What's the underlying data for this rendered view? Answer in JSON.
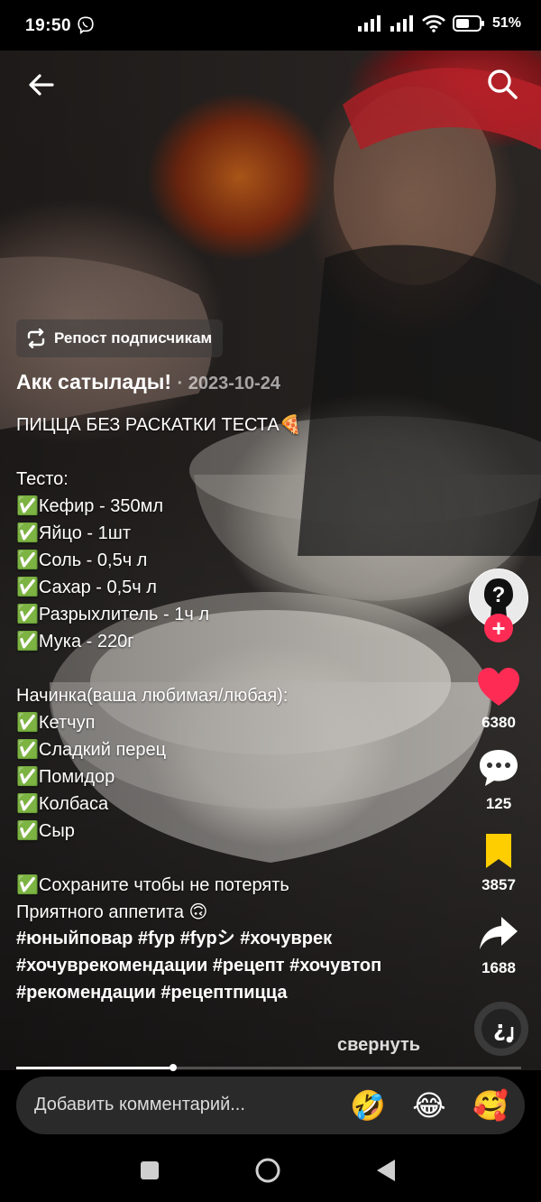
{
  "status_bar": {
    "time": "19:50",
    "battery": "51"
  },
  "header": {
    "back_icon": "arrow-left-icon",
    "search_icon": "search-icon"
  },
  "repost": {
    "label": "Репост подписчикам"
  },
  "post": {
    "author": "Акк сатылады!",
    "date": "· 2023-10-24",
    "description": "ПИЦЦА БЕЗ РАСКАТКИ ТЕСТА🍕\n\nТесто:\n✅Кефир - 350мл\n✅Яйцо - 1шт\n✅Соль - 0,5ч л\n✅Сахар - 0,5ч л\n✅Разрыхлитель - 1ч л\n✅Мука - 220г\n\nНачинка(ваша любимая/любая):\n✅Кетчуп\n✅Сладкий перец\n✅Помидор\n✅Колбаса\n✅Сыр\n\n✅Сохраните чтобы не потерять\nПриятного аппетита 🙃",
    "hashtags": "#юныйповар #fyp #fypシ #хочуврек #хочуврекомендации #рецепт #хочувтоп #рекомендации #рецептпицца",
    "collapse_label": "свернуть"
  },
  "actions": {
    "likes": "6380",
    "comments": "125",
    "saves": "3857",
    "shares": "1688"
  },
  "progress": {
    "fraction": 0.31
  },
  "comment_box": {
    "placeholder": "Добавить комментарий...",
    "emojis": [
      "🤣",
      "😂",
      "🥰"
    ]
  },
  "colors": {
    "like": "#fe2c55",
    "bookmark": "#fece00"
  }
}
